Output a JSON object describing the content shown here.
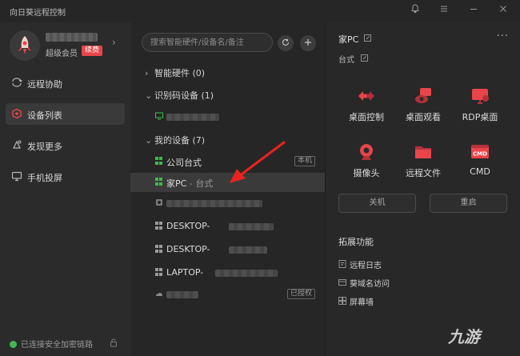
{
  "window": {
    "title": "向日葵远程控制",
    "controls": [
      "bell-icon",
      "menu-icon",
      "minimize-icon",
      "close-icon"
    ]
  },
  "profile": {
    "membership": "超级会员",
    "renew_label": "续费"
  },
  "nav": [
    {
      "label": "远程协助",
      "icon": "remote-assist-icon",
      "active": false
    },
    {
      "label": "设备列表",
      "icon": "device-list-icon",
      "active": true
    },
    {
      "label": "发现更多",
      "icon": "discover-icon",
      "active": false
    },
    {
      "label": "手机投屏",
      "icon": "screen-cast-icon",
      "active": false
    }
  ],
  "status": {
    "secure_link": "已连接安全加密链路"
  },
  "search": {
    "placeholder": "搜索智能硬件/设备名/备注"
  },
  "groups": {
    "smart_hardware": "智能硬件 (0)",
    "id_devices": "识别码设备 (1)",
    "my_devices": "我的设备 (7)"
  },
  "devices": {
    "company_pc": {
      "name": "公司台式",
      "tag": "本机"
    },
    "home_pc": {
      "name": "家PC",
      "sep": "-",
      "type": "台式"
    },
    "desktop_1": {
      "name": "DESKTOP-"
    },
    "desktop_2": {
      "name": "DESKTOP-"
    },
    "laptop": {
      "name": "LAPTOP-"
    },
    "authorized": {
      "tag": "已授权"
    }
  },
  "detail": {
    "name": "家PC",
    "type": "台式",
    "features": [
      {
        "label": "桌面控制",
        "icon": "desktop-control-icon"
      },
      {
        "label": "桌面观看",
        "icon": "desktop-view-icon"
      },
      {
        "label": "RDP桌面",
        "icon": "rdp-desktop-icon"
      },
      {
        "label": "摄像头",
        "icon": "camera-icon"
      },
      {
        "label": "远程文件",
        "icon": "remote-file-icon"
      },
      {
        "label": "CMD",
        "icon": "cmd-icon",
        "icon_text": "CMD"
      }
    ],
    "shutdown_label": "关机",
    "restart_label": "重启",
    "extensions_title": "拓展功能",
    "extensions": [
      {
        "label": "远程日志",
        "icon": "log-icon"
      },
      {
        "label": "葵域名访问",
        "icon": "domain-access-icon"
      },
      {
        "label": "屏幕墙",
        "icon": "screen-wall-icon"
      }
    ]
  },
  "watermark": "九游",
  "colors": {
    "accent_red": "#e8454a",
    "online_green": "#3fb950",
    "windows_green": "#3fb950"
  }
}
